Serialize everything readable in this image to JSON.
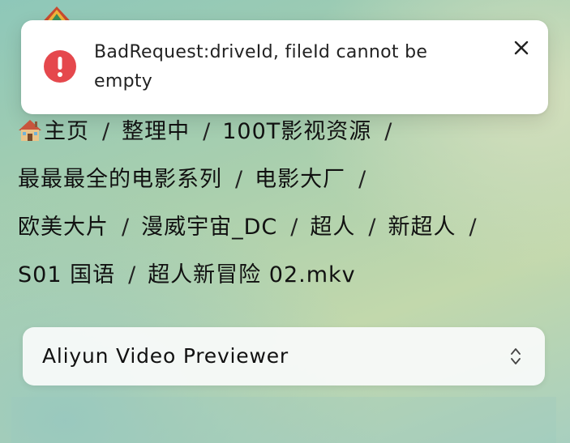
{
  "toast": {
    "message": "BadRequest:driveId, fileId cannot be empty",
    "icon": "error-icon",
    "close_icon": "close-icon",
    "accent_color": "#e5484d"
  },
  "breadcrumb": {
    "separator": "/",
    "home_icon": "house-emoji-icon",
    "items": [
      "主页",
      "整理中",
      "100T影视资源",
      "最最最全的电影系列",
      "电影大厂",
      "欧美大片",
      "漫威宇宙_DC",
      "超人",
      "新超人",
      "S01 国语"
    ],
    "current": "超人新冒险 02.mkv"
  },
  "previewer_select": {
    "value": "Aliyun Video Previewer",
    "icon": "chevron-up-down-icon"
  }
}
